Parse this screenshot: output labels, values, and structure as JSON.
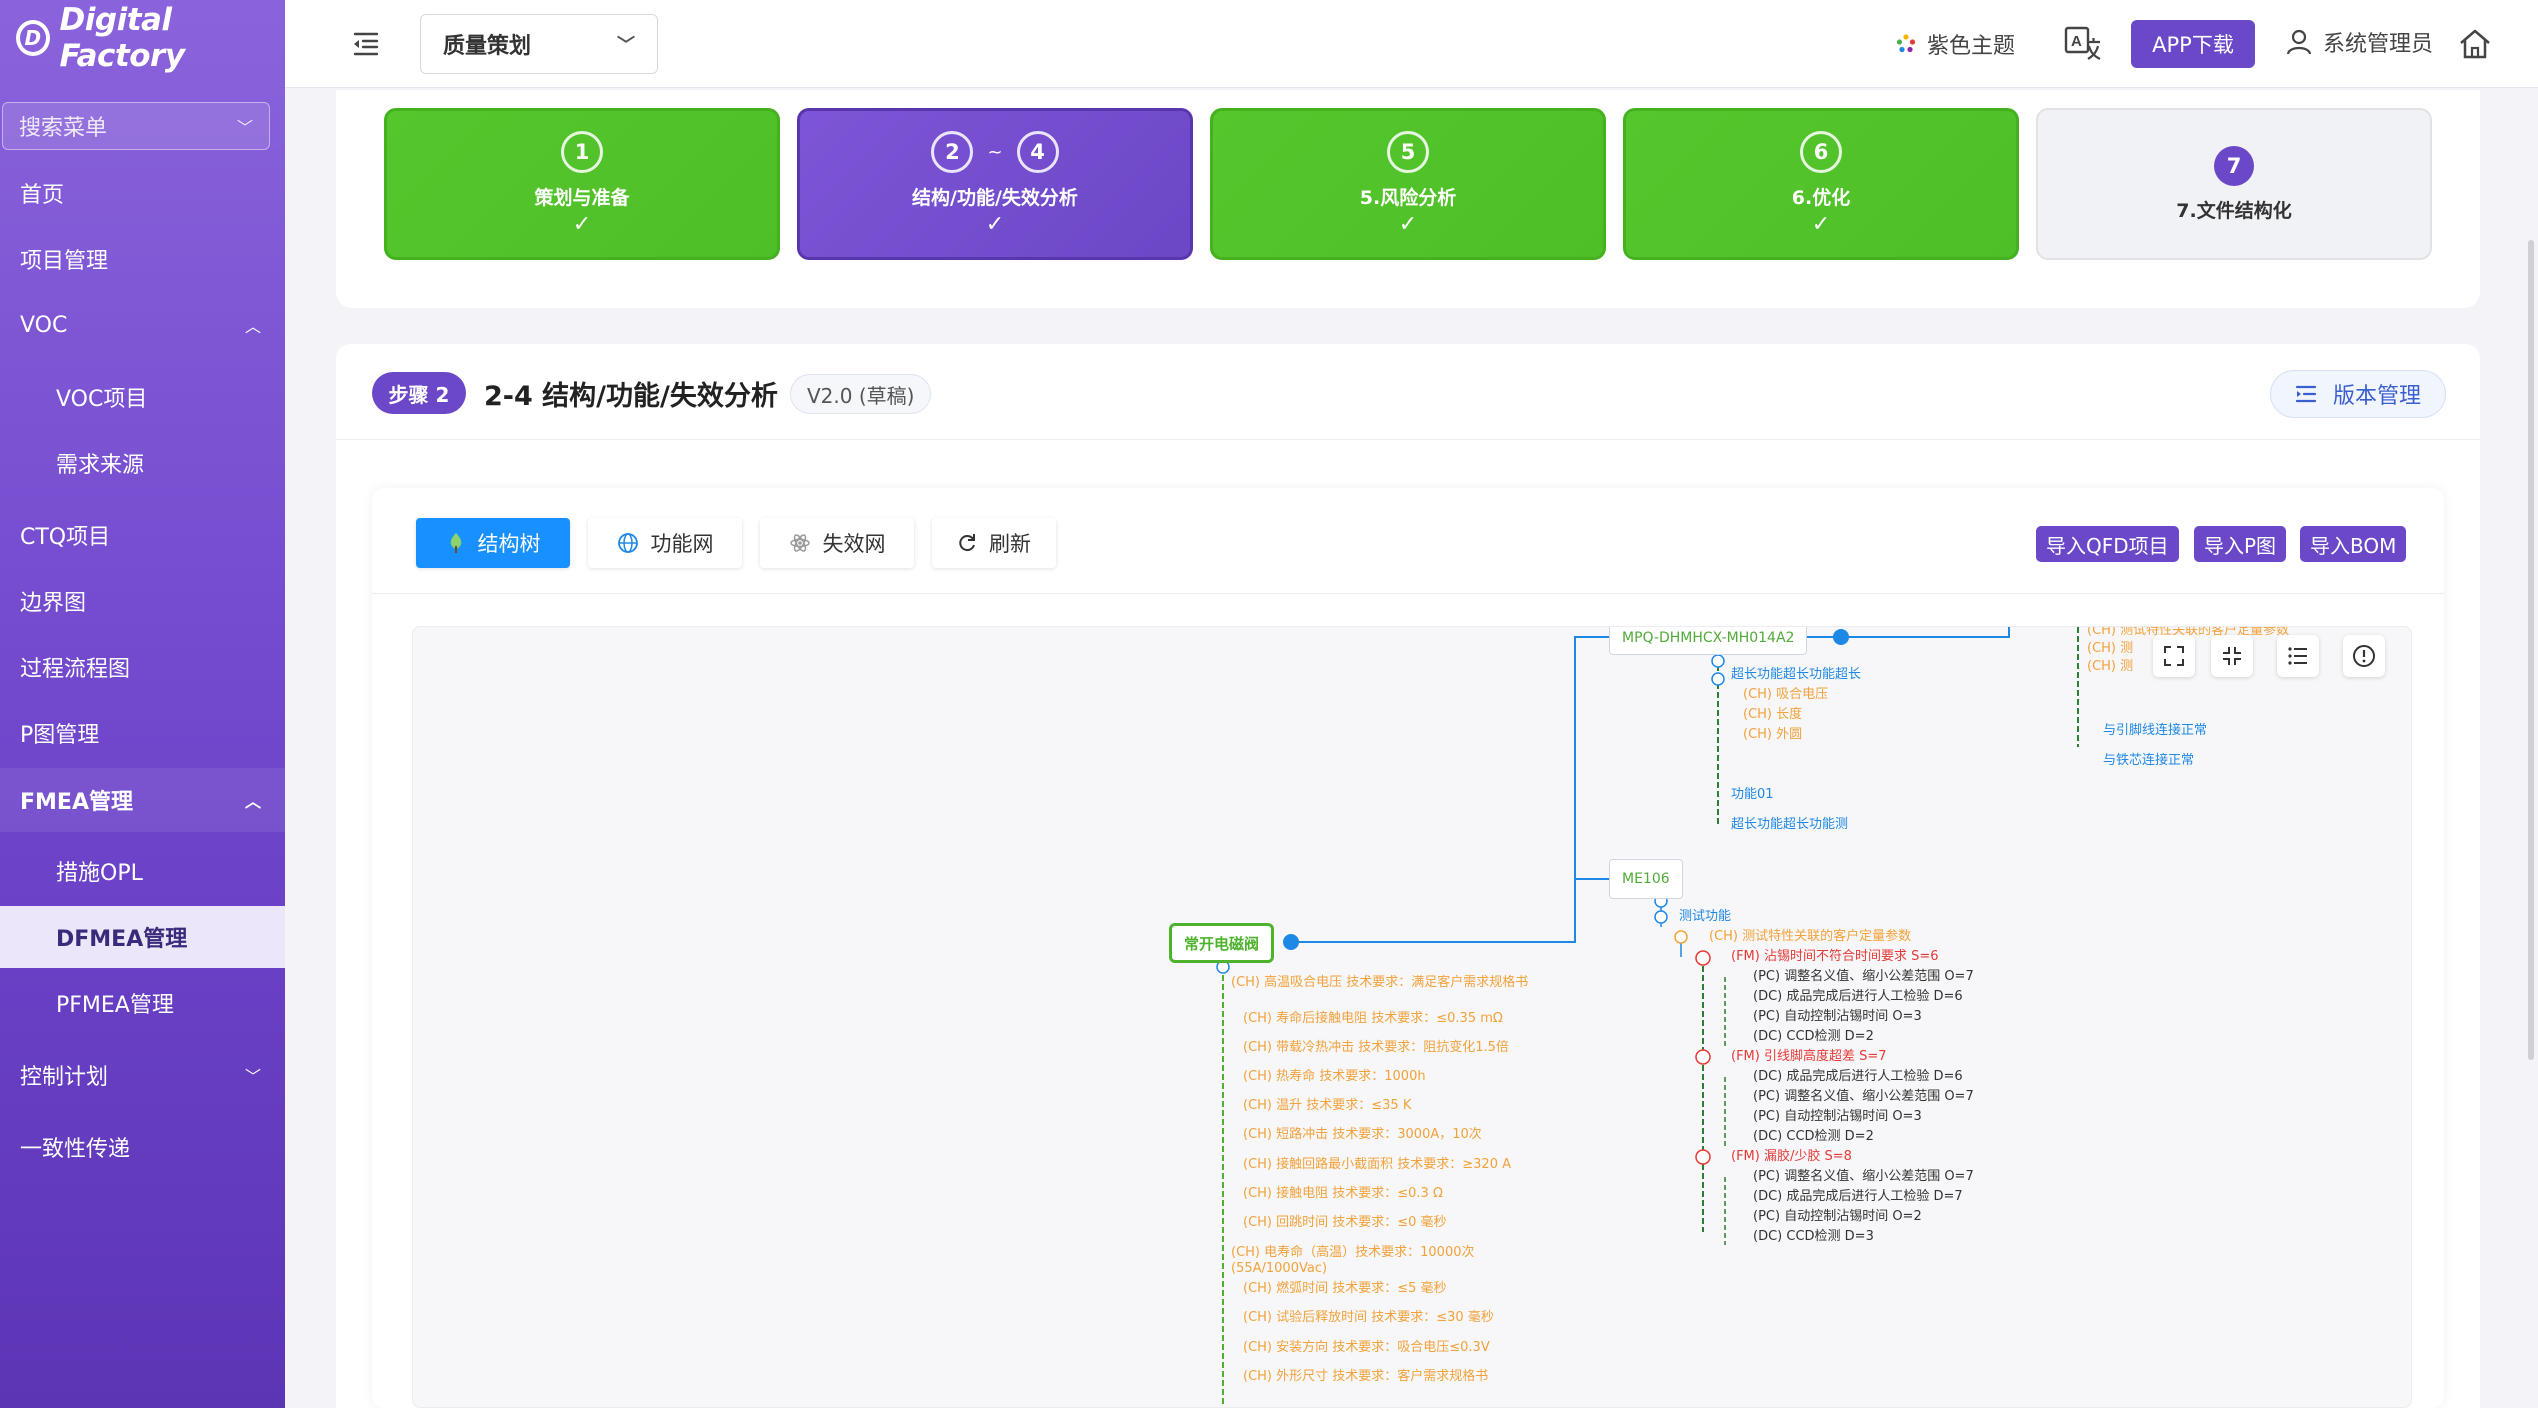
{
  "sidebar": {
    "logo_mark": "D",
    "logo_text": "Digital Factory",
    "search_placeholder": "搜索菜单",
    "items": {
      "home": "首页",
      "project": "项目管理",
      "voc": "VOC",
      "voc_project": "VOC项目",
      "demand_source": "需求来源",
      "ctq": "CTQ项目",
      "boundary": "边界图",
      "process_flow": "过程流程图",
      "p_diagram": "P图管理",
      "fmea": "FMEA管理",
      "opl": "措施OPL",
      "dfmea": "DFMEA管理",
      "pfmea": "PFMEA管理",
      "control_plan": "控制计划",
      "consistency": "一致性传递"
    }
  },
  "header": {
    "module": "质量策划",
    "theme": "紫色主题",
    "app_download": "APP下载",
    "user": "系统管理员"
  },
  "steps": [
    {
      "num": "1",
      "label": "策划与准备",
      "check": "✓"
    },
    {
      "num_a": "2",
      "tilde": "~",
      "num_b": "4",
      "label": "结构/功能/失效分析",
      "check": "✓"
    },
    {
      "num": "5",
      "label": "5.风险分析",
      "check": "✓"
    },
    {
      "num": "6",
      "label": "6.优化",
      "check": "✓"
    },
    {
      "num": "7",
      "label": "7.文件结构化"
    }
  ],
  "main": {
    "step_badge": "步骤 2",
    "title": "2-4 结构/功能/失效分析",
    "version": "V2.0 (草稿)",
    "version_button": "版本管理",
    "tabs": [
      "结构树",
      "功能网",
      "失效网",
      "刷新"
    ],
    "imports": [
      "导入QFD项目",
      "导入P图",
      "导入BOM"
    ]
  },
  "tree": {
    "root": "常开电磁阀",
    "node_a": "MPQ-DHMHCX-MH014A2",
    "node_b": "ME106",
    "a_fn1": "超长功能超长功能超长",
    "a_ch": [
      "(CH) 吸合电压",
      "(CH) 长度",
      "(CH) 外圆"
    ],
    "a_fn2": "功能01",
    "a_fn3": "超长功能超长功能测",
    "top_ch": [
      "(CH) 测试特性关联的客户定量参数",
      "(CH) 测",
      "(CH) 测"
    ],
    "top_fn": [
      "与引脚线连接正常",
      "与铁芯连接正常"
    ],
    "b_fn": "测试功能",
    "b_ch": "(CH) 测试特性关联的客户定量参数",
    "fm1": "(FM) 沾锡时间不符合时间要求 S=6",
    "fm1_items": [
      "(PC) 调整名义值、缩小公差范围 O=7",
      "(DC) 成品完成后进行人工检验 D=6",
      "(PC) 自动控制沾锡时间 O=3",
      "(DC) CCD检测 D=2"
    ],
    "fm2": "(FM) 引线脚高度超差 S=7",
    "fm2_items": [
      "(DC) 成品完成后进行人工检验 D=6",
      "(PC) 调整名义值、缩小公差范围 O=7",
      "(PC) 自动控制沾锡时间 O=3",
      "(DC) CCD检测 D=2"
    ],
    "fm3": "(FM) 漏胶/少胶 S=8",
    "fm3_items": [
      "(PC) 调整名义值、缩小公差范围 O=7",
      "(DC) 成品完成后进行人工检验 D=7",
      "(PC) 自动控制沾锡时间 O=2",
      "(DC) CCD检测 D=3"
    ],
    "root_ch": [
      "(CH) 高温吸合电压 技术要求：满足客户需求规格书",
      "(CH) 寿命后接触电阻 技术要求：≤0.35 mΩ",
      "(CH) 带载冷热冲击 技术要求：阻抗变化1.5倍",
      "(CH) 热寿命 技术要求：1000h",
      "(CH) 温升 技术要求：≤35 K",
      "(CH) 短路冲击 技术要求：3000A，10次",
      "(CH) 接触回路最小截面积 技术要求：≥320 A",
      "(CH) 接触电阻 技术要求：≤0.3 Ω",
      "(CH) 回跳时间 技术要求：≤0 毫秒",
      "(CH) 电寿命（高温）技术要求：10000次(55A/1000Vac)",
      "(CH) 燃弧时间 技术要求：≤5 毫秒",
      "(CH) 试验后释放时间 技术要求：≤30 毫秒",
      "(CH) 安装方向 技术要求：吸合电压≤0.3V",
      "(CH) 外形尺寸 技术要求：客户需求规格书"
    ]
  },
  "colors": {
    "sidebar": "#7a52d4",
    "accent": "#6b48c8",
    "step_done": "#52c42a",
    "tab_active": "#1890ff",
    "ch": "#f2a23a",
    "fn": "#1e88e5",
    "fm": "#e53935"
  }
}
